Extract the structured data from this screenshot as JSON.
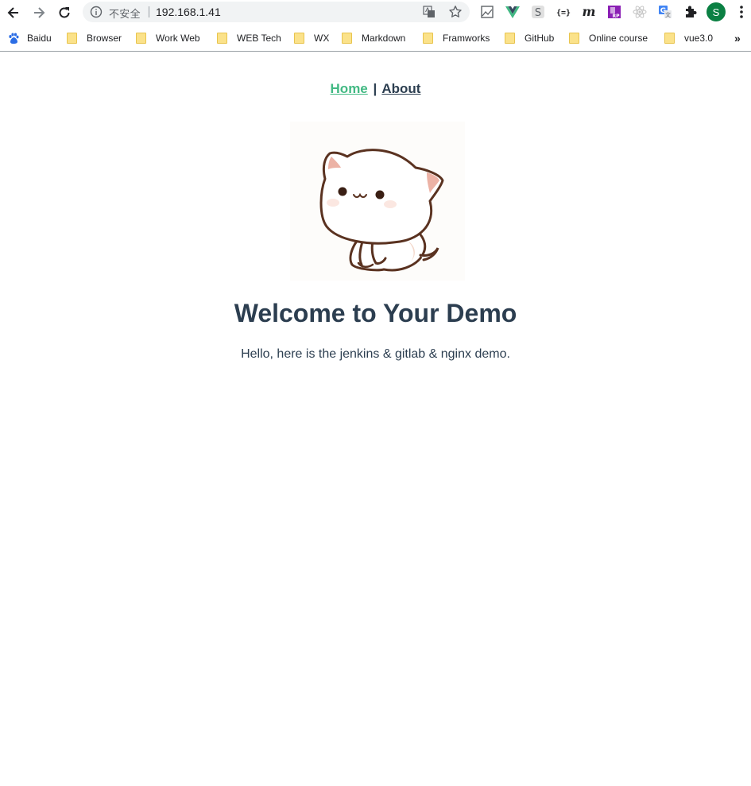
{
  "browser": {
    "address": {
      "security_label": "不安全",
      "url": "192.168.1.41"
    },
    "profile_initial": "S",
    "bookmarks": [
      {
        "label": "Baidu"
      },
      {
        "label": "Browser"
      },
      {
        "label": "Work Web"
      },
      {
        "label": "WEB Tech"
      },
      {
        "label": "WX"
      },
      {
        "label": "Markdown"
      },
      {
        "label": "Framworks"
      },
      {
        "label": "GitHub"
      },
      {
        "label": "Online course"
      },
      {
        "label": "vue3.0"
      }
    ],
    "bookmarks_overflow": "»",
    "extension_icons": [
      "screenshot-extension-icon",
      "vue-devtools-icon",
      "s-extension-icon",
      "json-viewer-icon",
      "m-extension-icon",
      "axure-rp-icon",
      "react-devtools-icon",
      "google-translate-icon",
      "puzzle-icon"
    ],
    "profile_color": "#0b8043"
  },
  "page": {
    "nav": {
      "home": "Home",
      "separator": "|",
      "about": "About"
    },
    "logo_icon": "cat-logo-image",
    "title": "Welcome to Your Demo",
    "subtitle": "Hello, here is the jenkins & gitlab & nginx demo.",
    "colors": {
      "active_link": "#42b983",
      "text": "#2c3e50"
    }
  }
}
